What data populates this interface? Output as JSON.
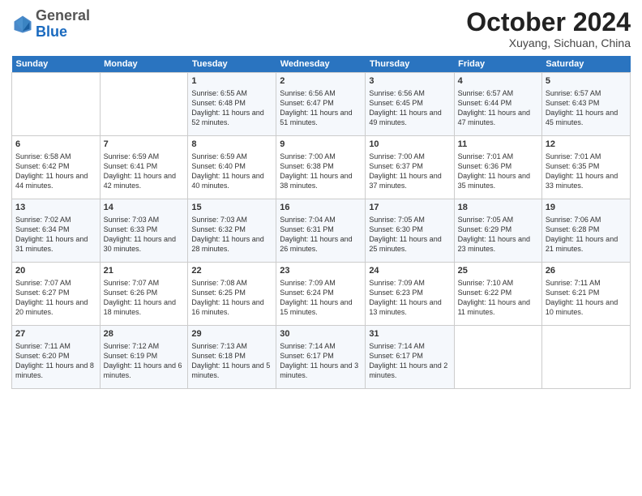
{
  "header": {
    "logo_line1": "General",
    "logo_line2": "Blue",
    "month": "October 2024",
    "location": "Xuyang, Sichuan, China"
  },
  "weekdays": [
    "Sunday",
    "Monday",
    "Tuesday",
    "Wednesday",
    "Thursday",
    "Friday",
    "Saturday"
  ],
  "weeks": [
    [
      {
        "day": "",
        "content": ""
      },
      {
        "day": "",
        "content": ""
      },
      {
        "day": "1",
        "content": "Sunrise: 6:55 AM\nSunset: 6:48 PM\nDaylight: 11 hours and 52 minutes."
      },
      {
        "day": "2",
        "content": "Sunrise: 6:56 AM\nSunset: 6:47 PM\nDaylight: 11 hours and 51 minutes."
      },
      {
        "day": "3",
        "content": "Sunrise: 6:56 AM\nSunset: 6:45 PM\nDaylight: 11 hours and 49 minutes."
      },
      {
        "day": "4",
        "content": "Sunrise: 6:57 AM\nSunset: 6:44 PM\nDaylight: 11 hours and 47 minutes."
      },
      {
        "day": "5",
        "content": "Sunrise: 6:57 AM\nSunset: 6:43 PM\nDaylight: 11 hours and 45 minutes."
      }
    ],
    [
      {
        "day": "6",
        "content": "Sunrise: 6:58 AM\nSunset: 6:42 PM\nDaylight: 11 hours and 44 minutes."
      },
      {
        "day": "7",
        "content": "Sunrise: 6:59 AM\nSunset: 6:41 PM\nDaylight: 11 hours and 42 minutes."
      },
      {
        "day": "8",
        "content": "Sunrise: 6:59 AM\nSunset: 6:40 PM\nDaylight: 11 hours and 40 minutes."
      },
      {
        "day": "9",
        "content": "Sunrise: 7:00 AM\nSunset: 6:38 PM\nDaylight: 11 hours and 38 minutes."
      },
      {
        "day": "10",
        "content": "Sunrise: 7:00 AM\nSunset: 6:37 PM\nDaylight: 11 hours and 37 minutes."
      },
      {
        "day": "11",
        "content": "Sunrise: 7:01 AM\nSunset: 6:36 PM\nDaylight: 11 hours and 35 minutes."
      },
      {
        "day": "12",
        "content": "Sunrise: 7:01 AM\nSunset: 6:35 PM\nDaylight: 11 hours and 33 minutes."
      }
    ],
    [
      {
        "day": "13",
        "content": "Sunrise: 7:02 AM\nSunset: 6:34 PM\nDaylight: 11 hours and 31 minutes."
      },
      {
        "day": "14",
        "content": "Sunrise: 7:03 AM\nSunset: 6:33 PM\nDaylight: 11 hours and 30 minutes."
      },
      {
        "day": "15",
        "content": "Sunrise: 7:03 AM\nSunset: 6:32 PM\nDaylight: 11 hours and 28 minutes."
      },
      {
        "day": "16",
        "content": "Sunrise: 7:04 AM\nSunset: 6:31 PM\nDaylight: 11 hours and 26 minutes."
      },
      {
        "day": "17",
        "content": "Sunrise: 7:05 AM\nSunset: 6:30 PM\nDaylight: 11 hours and 25 minutes."
      },
      {
        "day": "18",
        "content": "Sunrise: 7:05 AM\nSunset: 6:29 PM\nDaylight: 11 hours and 23 minutes."
      },
      {
        "day": "19",
        "content": "Sunrise: 7:06 AM\nSunset: 6:28 PM\nDaylight: 11 hours and 21 minutes."
      }
    ],
    [
      {
        "day": "20",
        "content": "Sunrise: 7:07 AM\nSunset: 6:27 PM\nDaylight: 11 hours and 20 minutes."
      },
      {
        "day": "21",
        "content": "Sunrise: 7:07 AM\nSunset: 6:26 PM\nDaylight: 11 hours and 18 minutes."
      },
      {
        "day": "22",
        "content": "Sunrise: 7:08 AM\nSunset: 6:25 PM\nDaylight: 11 hours and 16 minutes."
      },
      {
        "day": "23",
        "content": "Sunrise: 7:09 AM\nSunset: 6:24 PM\nDaylight: 11 hours and 15 minutes."
      },
      {
        "day": "24",
        "content": "Sunrise: 7:09 AM\nSunset: 6:23 PM\nDaylight: 11 hours and 13 minutes."
      },
      {
        "day": "25",
        "content": "Sunrise: 7:10 AM\nSunset: 6:22 PM\nDaylight: 11 hours and 11 minutes."
      },
      {
        "day": "26",
        "content": "Sunrise: 7:11 AM\nSunset: 6:21 PM\nDaylight: 11 hours and 10 minutes."
      }
    ],
    [
      {
        "day": "27",
        "content": "Sunrise: 7:11 AM\nSunset: 6:20 PM\nDaylight: 11 hours and 8 minutes."
      },
      {
        "day": "28",
        "content": "Sunrise: 7:12 AM\nSunset: 6:19 PM\nDaylight: 11 hours and 6 minutes."
      },
      {
        "day": "29",
        "content": "Sunrise: 7:13 AM\nSunset: 6:18 PM\nDaylight: 11 hours and 5 minutes."
      },
      {
        "day": "30",
        "content": "Sunrise: 7:14 AM\nSunset: 6:17 PM\nDaylight: 11 hours and 3 minutes."
      },
      {
        "day": "31",
        "content": "Sunrise: 7:14 AM\nSunset: 6:17 PM\nDaylight: 11 hours and 2 minutes."
      },
      {
        "day": "",
        "content": ""
      },
      {
        "day": "",
        "content": ""
      }
    ]
  ]
}
